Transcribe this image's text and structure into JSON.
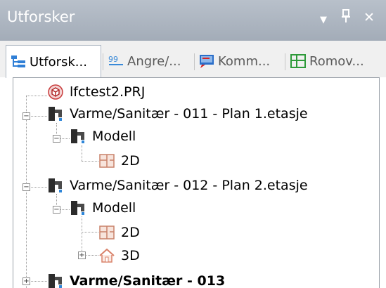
{
  "panel": {
    "title": "Utforsker",
    "controls": {
      "menu": "▼",
      "pin": "ᵖ",
      "close": "✕"
    }
  },
  "tabs": [
    {
      "label": "Utforsk...",
      "icon": "tree-view-icon",
      "active": true
    },
    {
      "label": "Angre/...",
      "icon": "undo-history-icon",
      "active": false
    },
    {
      "label": "Komm...",
      "icon": "comments-icon",
      "active": false
    },
    {
      "label": "Romov...",
      "icon": "room-overview-icon",
      "active": false
    }
  ],
  "tree": {
    "root": {
      "label": "lfctest2.PRJ",
      "icon": "project-icon"
    },
    "items": [
      {
        "label": "Varme/Sanitær - 011 - Plan 1.etasje",
        "icon": "faucet-icon"
      },
      {
        "label": "Modell",
        "icon": "faucet-icon"
      },
      {
        "label": "2D",
        "icon": "plan-2d-icon"
      },
      {
        "label": "Varme/Sanitær - 012 - Plan 2.etasje",
        "icon": "faucet-icon"
      },
      {
        "label": "Modell",
        "icon": "faucet-icon"
      },
      {
        "label": "2D",
        "icon": "plan-2d-icon"
      },
      {
        "label": "3D",
        "icon": "house-3d-icon"
      },
      {
        "label": "Varme/Sanitær - 013",
        "icon": "faucet-icon"
      }
    ]
  },
  "colors": {
    "titlebar": "#a9b2bd",
    "tab_border": "#aeb7c3",
    "tree_border": "#9aa1a9"
  }
}
